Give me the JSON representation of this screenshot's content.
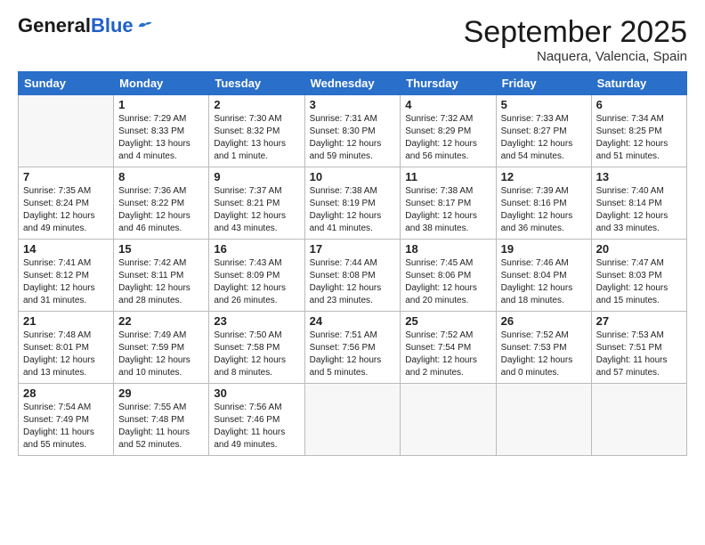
{
  "header": {
    "logo_general": "General",
    "logo_blue": "Blue",
    "month_title": "September 2025",
    "location": "Naquera, Valencia, Spain"
  },
  "weekdays": [
    "Sunday",
    "Monday",
    "Tuesday",
    "Wednesday",
    "Thursday",
    "Friday",
    "Saturday"
  ],
  "weeks": [
    [
      {
        "day": "",
        "sunrise": "",
        "sunset": "",
        "daylight": ""
      },
      {
        "day": "1",
        "sunrise": "Sunrise: 7:29 AM",
        "sunset": "Sunset: 8:33 PM",
        "daylight": "Daylight: 13 hours and 4 minutes."
      },
      {
        "day": "2",
        "sunrise": "Sunrise: 7:30 AM",
        "sunset": "Sunset: 8:32 PM",
        "daylight": "Daylight: 13 hours and 1 minute."
      },
      {
        "day": "3",
        "sunrise": "Sunrise: 7:31 AM",
        "sunset": "Sunset: 8:30 PM",
        "daylight": "Daylight: 12 hours and 59 minutes."
      },
      {
        "day": "4",
        "sunrise": "Sunrise: 7:32 AM",
        "sunset": "Sunset: 8:29 PM",
        "daylight": "Daylight: 12 hours and 56 minutes."
      },
      {
        "day": "5",
        "sunrise": "Sunrise: 7:33 AM",
        "sunset": "Sunset: 8:27 PM",
        "daylight": "Daylight: 12 hours and 54 minutes."
      },
      {
        "day": "6",
        "sunrise": "Sunrise: 7:34 AM",
        "sunset": "Sunset: 8:25 PM",
        "daylight": "Daylight: 12 hours and 51 minutes."
      }
    ],
    [
      {
        "day": "7",
        "sunrise": "Sunrise: 7:35 AM",
        "sunset": "Sunset: 8:24 PM",
        "daylight": "Daylight: 12 hours and 49 minutes."
      },
      {
        "day": "8",
        "sunrise": "Sunrise: 7:36 AM",
        "sunset": "Sunset: 8:22 PM",
        "daylight": "Daylight: 12 hours and 46 minutes."
      },
      {
        "day": "9",
        "sunrise": "Sunrise: 7:37 AM",
        "sunset": "Sunset: 8:21 PM",
        "daylight": "Daylight: 12 hours and 43 minutes."
      },
      {
        "day": "10",
        "sunrise": "Sunrise: 7:38 AM",
        "sunset": "Sunset: 8:19 PM",
        "daylight": "Daylight: 12 hours and 41 minutes."
      },
      {
        "day": "11",
        "sunrise": "Sunrise: 7:38 AM",
        "sunset": "Sunset: 8:17 PM",
        "daylight": "Daylight: 12 hours and 38 minutes."
      },
      {
        "day": "12",
        "sunrise": "Sunrise: 7:39 AM",
        "sunset": "Sunset: 8:16 PM",
        "daylight": "Daylight: 12 hours and 36 minutes."
      },
      {
        "day": "13",
        "sunrise": "Sunrise: 7:40 AM",
        "sunset": "Sunset: 8:14 PM",
        "daylight": "Daylight: 12 hours and 33 minutes."
      }
    ],
    [
      {
        "day": "14",
        "sunrise": "Sunrise: 7:41 AM",
        "sunset": "Sunset: 8:12 PM",
        "daylight": "Daylight: 12 hours and 31 minutes."
      },
      {
        "day": "15",
        "sunrise": "Sunrise: 7:42 AM",
        "sunset": "Sunset: 8:11 PM",
        "daylight": "Daylight: 12 hours and 28 minutes."
      },
      {
        "day": "16",
        "sunrise": "Sunrise: 7:43 AM",
        "sunset": "Sunset: 8:09 PM",
        "daylight": "Daylight: 12 hours and 26 minutes."
      },
      {
        "day": "17",
        "sunrise": "Sunrise: 7:44 AM",
        "sunset": "Sunset: 8:08 PM",
        "daylight": "Daylight: 12 hours and 23 minutes."
      },
      {
        "day": "18",
        "sunrise": "Sunrise: 7:45 AM",
        "sunset": "Sunset: 8:06 PM",
        "daylight": "Daylight: 12 hours and 20 minutes."
      },
      {
        "day": "19",
        "sunrise": "Sunrise: 7:46 AM",
        "sunset": "Sunset: 8:04 PM",
        "daylight": "Daylight: 12 hours and 18 minutes."
      },
      {
        "day": "20",
        "sunrise": "Sunrise: 7:47 AM",
        "sunset": "Sunset: 8:03 PM",
        "daylight": "Daylight: 12 hours and 15 minutes."
      }
    ],
    [
      {
        "day": "21",
        "sunrise": "Sunrise: 7:48 AM",
        "sunset": "Sunset: 8:01 PM",
        "daylight": "Daylight: 12 hours and 13 minutes."
      },
      {
        "day": "22",
        "sunrise": "Sunrise: 7:49 AM",
        "sunset": "Sunset: 7:59 PM",
        "daylight": "Daylight: 12 hours and 10 minutes."
      },
      {
        "day": "23",
        "sunrise": "Sunrise: 7:50 AM",
        "sunset": "Sunset: 7:58 PM",
        "daylight": "Daylight: 12 hours and 8 minutes."
      },
      {
        "day": "24",
        "sunrise": "Sunrise: 7:51 AM",
        "sunset": "Sunset: 7:56 PM",
        "daylight": "Daylight: 12 hours and 5 minutes."
      },
      {
        "day": "25",
        "sunrise": "Sunrise: 7:52 AM",
        "sunset": "Sunset: 7:54 PM",
        "daylight": "Daylight: 12 hours and 2 minutes."
      },
      {
        "day": "26",
        "sunrise": "Sunrise: 7:52 AM",
        "sunset": "Sunset: 7:53 PM",
        "daylight": "Daylight: 12 hours and 0 minutes."
      },
      {
        "day": "27",
        "sunrise": "Sunrise: 7:53 AM",
        "sunset": "Sunset: 7:51 PM",
        "daylight": "Daylight: 11 hours and 57 minutes."
      }
    ],
    [
      {
        "day": "28",
        "sunrise": "Sunrise: 7:54 AM",
        "sunset": "Sunset: 7:49 PM",
        "daylight": "Daylight: 11 hours and 55 minutes."
      },
      {
        "day": "29",
        "sunrise": "Sunrise: 7:55 AM",
        "sunset": "Sunset: 7:48 PM",
        "daylight": "Daylight: 11 hours and 52 minutes."
      },
      {
        "day": "30",
        "sunrise": "Sunrise: 7:56 AM",
        "sunset": "Sunset: 7:46 PM",
        "daylight": "Daylight: 11 hours and 49 minutes."
      },
      {
        "day": "",
        "sunrise": "",
        "sunset": "",
        "daylight": ""
      },
      {
        "day": "",
        "sunrise": "",
        "sunset": "",
        "daylight": ""
      },
      {
        "day": "",
        "sunrise": "",
        "sunset": "",
        "daylight": ""
      },
      {
        "day": "",
        "sunrise": "",
        "sunset": "",
        "daylight": ""
      }
    ]
  ]
}
